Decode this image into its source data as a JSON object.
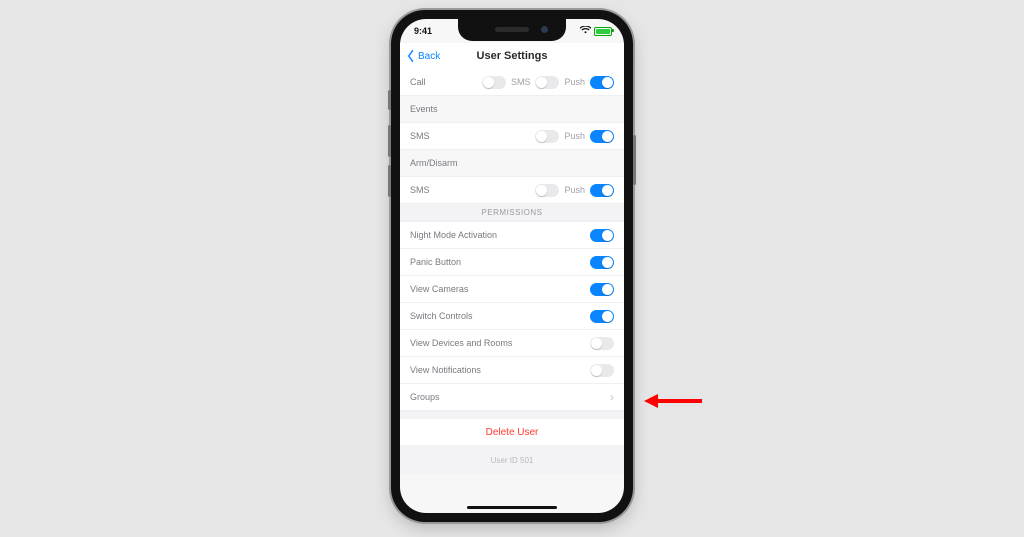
{
  "status": {
    "time": "9:41"
  },
  "nav": {
    "back": "Back",
    "title": "User Settings"
  },
  "alarms": {
    "call_label": "Call",
    "sms_label": "SMS",
    "push_label": "Push",
    "call_on": false,
    "sms_on": false,
    "push_on": true
  },
  "events": {
    "header": "Events",
    "sms_label": "SMS",
    "push_label": "Push",
    "sms_on": false,
    "push_on": true
  },
  "armdisarm": {
    "header": "Arm/Disarm",
    "sms_label": "SMS",
    "push_label": "Push",
    "sms_on": false,
    "push_on": true
  },
  "permissions_header": "PERMISSIONS",
  "perms": {
    "night_mode": {
      "label": "Night Mode Activation",
      "on": true
    },
    "panic": {
      "label": "Panic Button",
      "on": true
    },
    "cameras": {
      "label": "View Cameras",
      "on": true
    },
    "switches": {
      "label": "Switch Controls",
      "on": true
    },
    "devices_rooms": {
      "label": "View Devices and Rooms",
      "on": false
    },
    "notifications": {
      "label": "View Notifications",
      "on": false
    }
  },
  "groups_label": "Groups",
  "delete_label": "Delete User",
  "footer": "User ID 501"
}
